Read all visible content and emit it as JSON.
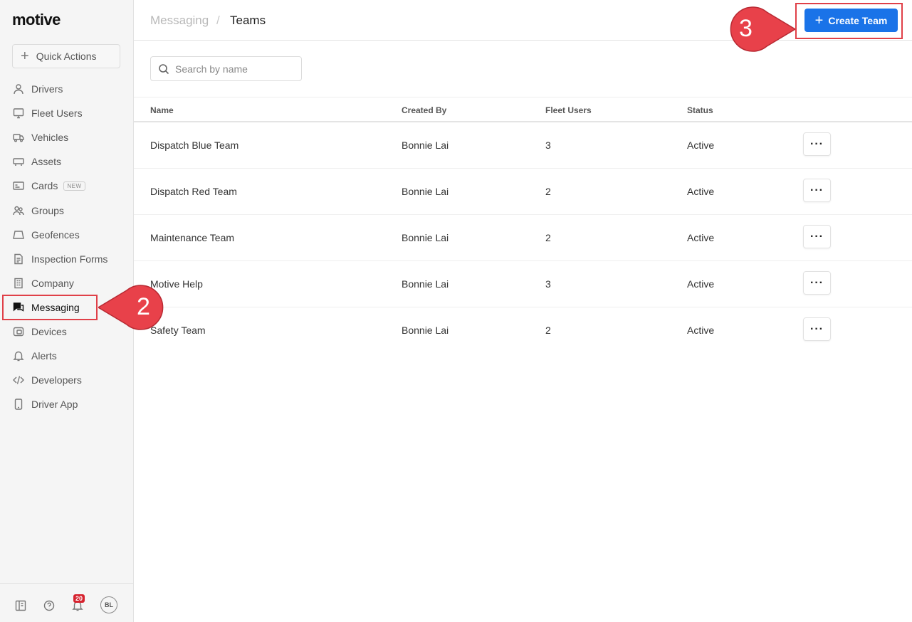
{
  "app": {
    "logo": "motive"
  },
  "sidebar": {
    "quick_actions": "Quick Actions",
    "items": [
      {
        "label": "Drivers",
        "icon": "person-icon"
      },
      {
        "label": "Fleet Users",
        "icon": "monitor-icon"
      },
      {
        "label": "Vehicles",
        "icon": "truck-icon"
      },
      {
        "label": "Assets",
        "icon": "trailer-icon"
      },
      {
        "label": "Cards",
        "icon": "card-icon",
        "badge": "NEW"
      },
      {
        "label": "Groups",
        "icon": "group-icon"
      },
      {
        "label": "Geofences",
        "icon": "geofence-icon"
      },
      {
        "label": "Inspection Forms",
        "icon": "document-icon"
      },
      {
        "label": "Company",
        "icon": "building-icon"
      },
      {
        "label": "Messaging",
        "icon": "chat-icon",
        "active": true
      },
      {
        "label": "Devices",
        "icon": "device-icon"
      },
      {
        "label": "Alerts",
        "icon": "bell-icon"
      },
      {
        "label": "Developers",
        "icon": "code-icon"
      },
      {
        "label": "Driver App",
        "icon": "phone-icon"
      }
    ],
    "footer": {
      "notifications_count": "20",
      "avatar_initials": "BL"
    }
  },
  "header": {
    "breadcrumb_parent": "Messaging",
    "breadcrumb_sep": "/",
    "breadcrumb_current": "Teams",
    "create_button": "Create Team"
  },
  "search": {
    "placeholder": "Search by name"
  },
  "table": {
    "columns": [
      "Name",
      "Created By",
      "Fleet Users",
      "Status"
    ],
    "rows": [
      [
        "Dispatch Blue Team",
        "Bonnie Lai",
        "3",
        "Active"
      ],
      [
        "Dispatch Red Team",
        "Bonnie Lai",
        "2",
        "Active"
      ],
      [
        "Maintenance Team",
        "Bonnie Lai",
        "2",
        "Active"
      ],
      [
        "Motive Help",
        "Bonnie Lai",
        "3",
        "Active"
      ],
      [
        "Safety Team",
        "Bonnie Lai",
        "2",
        "Active"
      ]
    ],
    "row_action": "···"
  },
  "annotations": {
    "step_2": "2",
    "step_3": "3",
    "accent": "#e8414a"
  }
}
